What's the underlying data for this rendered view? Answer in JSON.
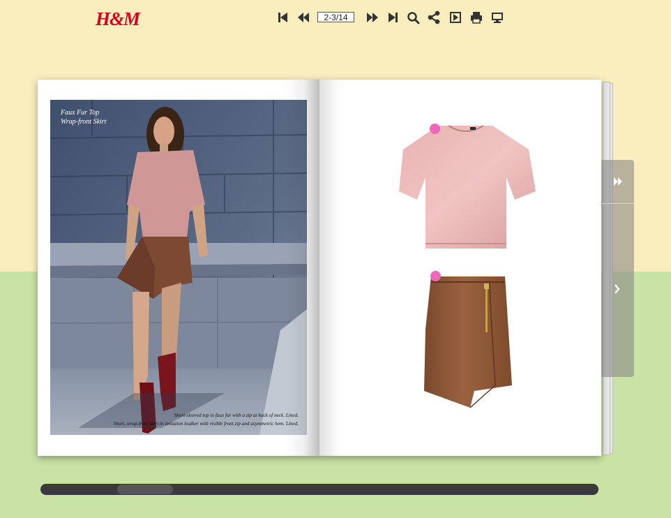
{
  "colors": {
    "top_background": "#fbeebe",
    "bottom_background": "#c9e2a6",
    "logo_red": "#d6001c",
    "hotspot_pink": "#f066b8",
    "toolbar_icon": "#333333"
  },
  "header": {
    "logo_text": "H&M"
  },
  "toolbar": {
    "page_indicator": "2-3/14",
    "icons": [
      "first-page-icon",
      "previous-page-icon",
      "next-page-icon",
      "last-page-icon",
      "search-icon",
      "share-icon",
      "autoplay-icon",
      "print-icon",
      "fullscreen-icon"
    ]
  },
  "left_page": {
    "title_line1": "Faux Fur Top",
    "title_line2": "Wrap-front Skirt",
    "caption_line1": "Short-sleeved top in faux fur with a zip at back of neck. Lined.",
    "caption_line2": "Short, wrap-front skirt in imitation leather with visible front zip and asymmetric hem. Lined."
  },
  "right_page": {
    "products": [
      "pink faux fur top",
      "brown imitation leather wrap skirt"
    ]
  },
  "side_nav": {
    "icons": [
      "fast-forward-icon",
      "next-arrow-icon"
    ]
  }
}
